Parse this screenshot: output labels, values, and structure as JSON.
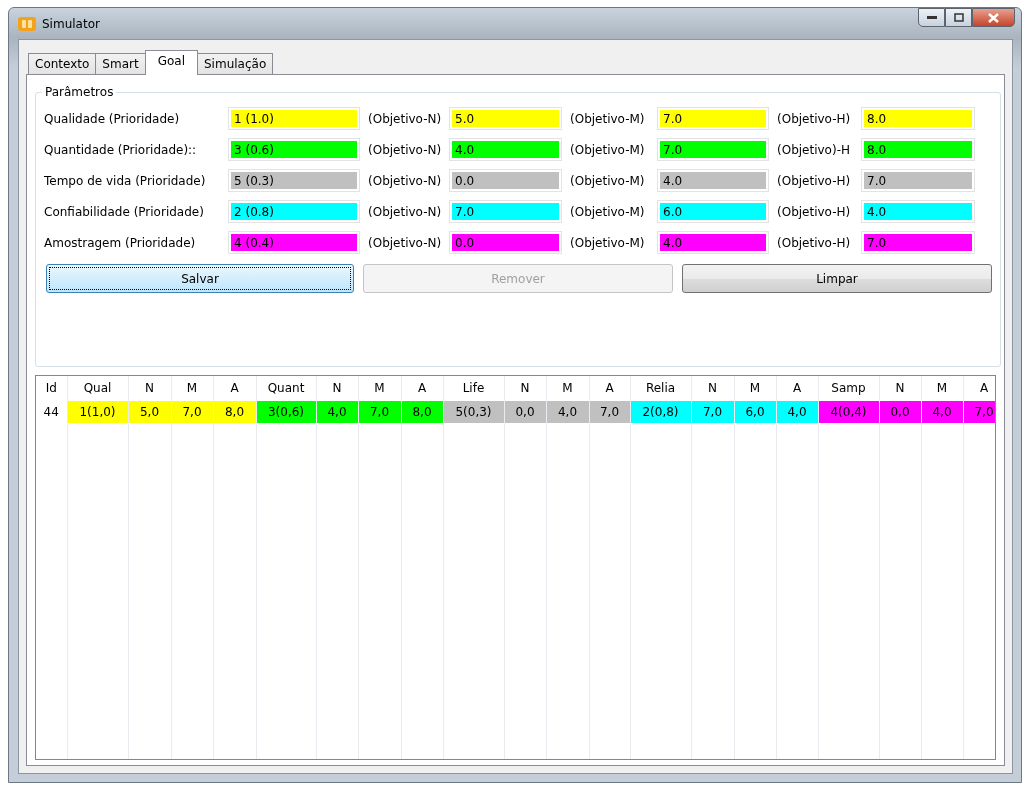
{
  "window": {
    "title": "Simulator"
  },
  "tabs": [
    {
      "label": "Contexto",
      "selected": false
    },
    {
      "label": "Smart",
      "selected": false
    },
    {
      "label": "Goal",
      "selected": true
    },
    {
      "label": "Simulação",
      "selected": false
    }
  ],
  "parameters": {
    "title": "Parâmetros",
    "rows": [
      {
        "label": "Qualidade (Prioridade)",
        "priority": "1 (1.0)",
        "color": "#ffff00",
        "objectives": [
          {
            "label": "(Objetivo-N)",
            "value": "5.0"
          },
          {
            "label": "(Objetivo-M)",
            "value": "7.0"
          },
          {
            "label": "(Objetivo-H)",
            "value": "8.0"
          }
        ]
      },
      {
        "label": "Quantidade (Prioridade)::",
        "priority": "3 (0.6)",
        "color": "#00ff00",
        "objectives": [
          {
            "label": "(Objetivo-N)",
            "value": "4.0"
          },
          {
            "label": "(Objetivo-M)",
            "value": "7.0"
          },
          {
            "label": "(Objetivo)-H",
            "value": "8.0"
          }
        ]
      },
      {
        "label": "Tempo de vida (Prioridade)",
        "priority": "5 (0.3)",
        "color": "#c0c0c0",
        "objectives": [
          {
            "label": "(Objetivo-N)",
            "value": "0.0"
          },
          {
            "label": "(Objetivo-M)",
            "value": "4.0"
          },
          {
            "label": "(Objetivo-H)",
            "value": "7.0"
          }
        ]
      },
      {
        "label": "Confiabilidade (Prioridade)",
        "priority": "2 (0.8)",
        "color": "#00ffff",
        "objectives": [
          {
            "label": "(Objetivo-N)",
            "value": "7.0"
          },
          {
            "label": "(Objetivo-M)",
            "value": "6.0"
          },
          {
            "label": "(Objetivo-H)",
            "value": "4.0"
          }
        ]
      },
      {
        "label": "Amostragem (Prioridade)",
        "priority": "4 (0.4)",
        "color": "#ff00ff",
        "objectives": [
          {
            "label": "(Objetivo-N)",
            "value": "0.0"
          },
          {
            "label": "(Objetivo-M)",
            "value": "4.0"
          },
          {
            "label": "(Objetivo-H)",
            "value": "7.0"
          }
        ]
      }
    ]
  },
  "buttons": [
    {
      "label": "Salvar",
      "disabled": false,
      "focused": true
    },
    {
      "label": "Remover",
      "disabled": true,
      "focused": false
    },
    {
      "label": "Limpar",
      "disabled": false,
      "focused": false
    }
  ],
  "table": {
    "columns": [
      "Id",
      "Qual",
      "N",
      "M",
      "A",
      "Quant",
      "N",
      "M",
      "A",
      "Life",
      "N",
      "M",
      "A",
      "Relia",
      "N",
      "M",
      "A",
      "Samp",
      "N",
      "M",
      "A"
    ],
    "rows": [
      [
        {
          "text": "44"
        },
        {
          "text": "1(1,0)",
          "color": "#ffff00"
        },
        {
          "text": "5,0",
          "color": "#ffff00"
        },
        {
          "text": "7,0",
          "color": "#ffff00"
        },
        {
          "text": "8,0",
          "color": "#ffff00"
        },
        {
          "text": "3(0,6)",
          "color": "#00ff00"
        },
        {
          "text": "4,0",
          "color": "#00ff00"
        },
        {
          "text": "7,0",
          "color": "#00ff00"
        },
        {
          "text": "8,0",
          "color": "#00ff00"
        },
        {
          "text": "5(0,3)",
          "color": "#c0c0c0"
        },
        {
          "text": "0,0",
          "color": "#c0c0c0"
        },
        {
          "text": "4,0",
          "color": "#c0c0c0"
        },
        {
          "text": "7,0",
          "color": "#c0c0c0"
        },
        {
          "text": "2(0,8)",
          "color": "#00ffff"
        },
        {
          "text": "7,0",
          "color": "#00ffff"
        },
        {
          "text": "6,0",
          "color": "#00ffff"
        },
        {
          "text": "4,0",
          "color": "#00ffff"
        },
        {
          "text": "4(0,4)",
          "color": "#ff00ff"
        },
        {
          "text": "0,0",
          "color": "#ff00ff"
        },
        {
          "text": "4,0",
          "color": "#ff00ff"
        },
        {
          "text": "7,0",
          "color": "#ff00ff"
        }
      ]
    ]
  }
}
